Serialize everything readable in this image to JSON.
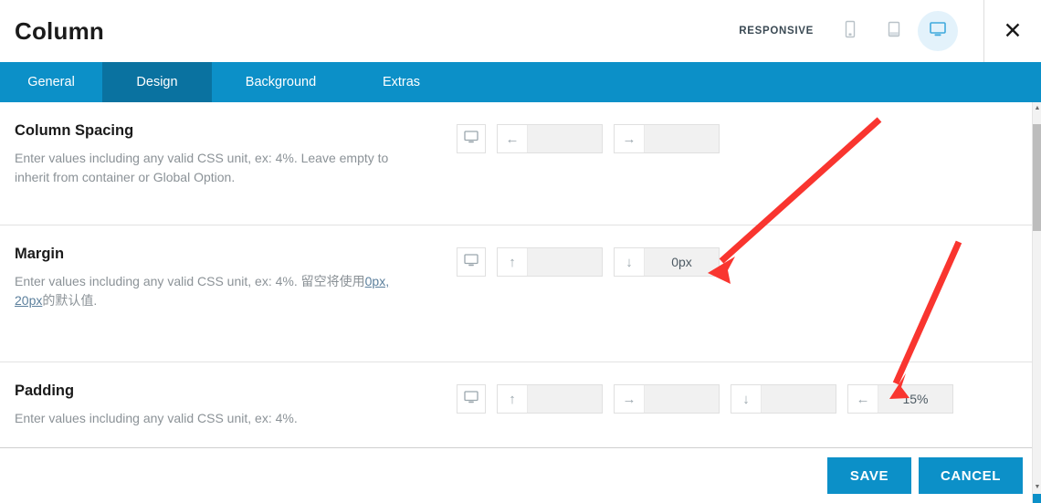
{
  "header": {
    "title": "Column",
    "responsive_label": "RESPONSIVE",
    "devices": [
      {
        "name": "mobile-icon",
        "active": false
      },
      {
        "name": "tablet-icon",
        "active": false
      },
      {
        "name": "desktop-icon",
        "active": true
      }
    ],
    "close_label": "✕"
  },
  "tabs": [
    {
      "label": "General",
      "active": false
    },
    {
      "label": "Design",
      "active": true
    },
    {
      "label": "Background",
      "active": false
    },
    {
      "label": "Extras",
      "active": false
    }
  ],
  "rows": {
    "column_spacing": {
      "title": "Column Spacing",
      "desc": "Enter values including any valid CSS unit, ex: 4%. Leave empty to inherit from container or Global Option.",
      "device_icon": "desktop-icon",
      "fields": [
        {
          "icon": "arrow-left-icon",
          "glyph": "←",
          "value": "",
          "placeholder": ""
        },
        {
          "icon": "arrow-right-icon",
          "glyph": "→",
          "value": "",
          "placeholder": ""
        }
      ]
    },
    "margin": {
      "title": "Margin",
      "desc_pre": "Enter values including any valid CSS unit, ex: 4%. 留空将使用",
      "desc_link": "0px, 20px",
      "desc_post": "的默认值.",
      "device_icon": "desktop-icon",
      "fields": [
        {
          "icon": "arrow-up-icon",
          "glyph": "↑",
          "value": "",
          "placeholder": ""
        },
        {
          "icon": "arrow-down-icon",
          "glyph": "↓",
          "value": "0px",
          "placeholder": ""
        }
      ]
    },
    "padding": {
      "title": "Padding",
      "desc": "Enter values including any valid CSS unit, ex: 4%.",
      "device_icon": "desktop-icon",
      "fields": [
        {
          "icon": "arrow-up-icon",
          "glyph": "↑",
          "value": "",
          "placeholder": ""
        },
        {
          "icon": "arrow-right-icon",
          "glyph": "→",
          "value": "",
          "placeholder": ""
        },
        {
          "icon": "arrow-down-icon",
          "glyph": "↓",
          "value": "",
          "placeholder": ""
        },
        {
          "icon": "arrow-left-icon",
          "glyph": "←",
          "value": "15%",
          "placeholder": ""
        }
      ]
    }
  },
  "footer": {
    "save_label": "SAVE",
    "cancel_label": "CANCEL"
  },
  "colors": {
    "accent": "#0c90c8",
    "accent_dark": "#0a72a0",
    "annotation": "#f9352f",
    "field_bg": "#f1f1f1"
  },
  "annotations": [
    {
      "name": "arrow-to-margin-bottom-field",
      "color": "#f9352f"
    },
    {
      "name": "arrow-to-padding-left-field",
      "color": "#f9352f"
    }
  ]
}
